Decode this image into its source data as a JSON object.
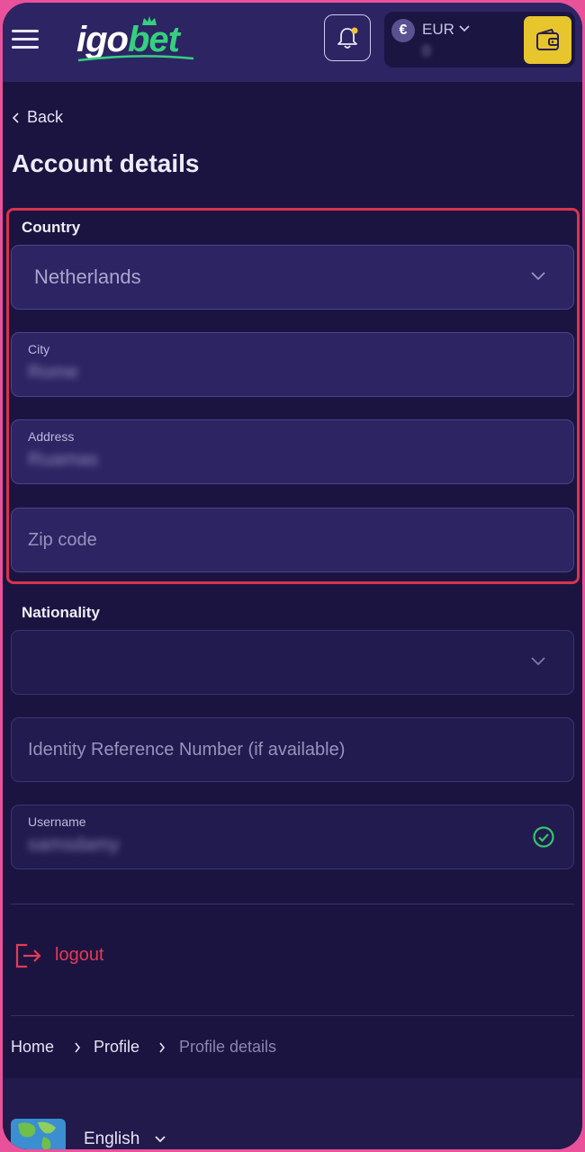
{
  "header": {
    "logo_part1": "igo",
    "logo_part2": "bet",
    "currency": "EUR",
    "currency_symbol": "€",
    "balance": "0"
  },
  "nav": {
    "back_label": "Back"
  },
  "page_title": "Account details",
  "form": {
    "country": {
      "label": "Country",
      "value": "Netherlands"
    },
    "city": {
      "label": "City",
      "value": "Rome"
    },
    "address": {
      "label": "Address",
      "value": "Ruamas"
    },
    "zip": {
      "placeholder": "Zip code"
    },
    "nationality": {
      "label": "Nationality",
      "value": ""
    },
    "identity": {
      "placeholder": "Identity Reference Number (if available)"
    },
    "username": {
      "label": "Username",
      "value": "samsdamy"
    }
  },
  "logout_label": "logout",
  "breadcrumb": [
    "Home",
    "Profile",
    "Profile details"
  ],
  "footer": {
    "language": "English"
  },
  "colors": {
    "accent_red": "#d9334a",
    "logo_green": "#35d07f",
    "wallet_yellow": "#e7c52d",
    "success_green": "#35c46a"
  }
}
